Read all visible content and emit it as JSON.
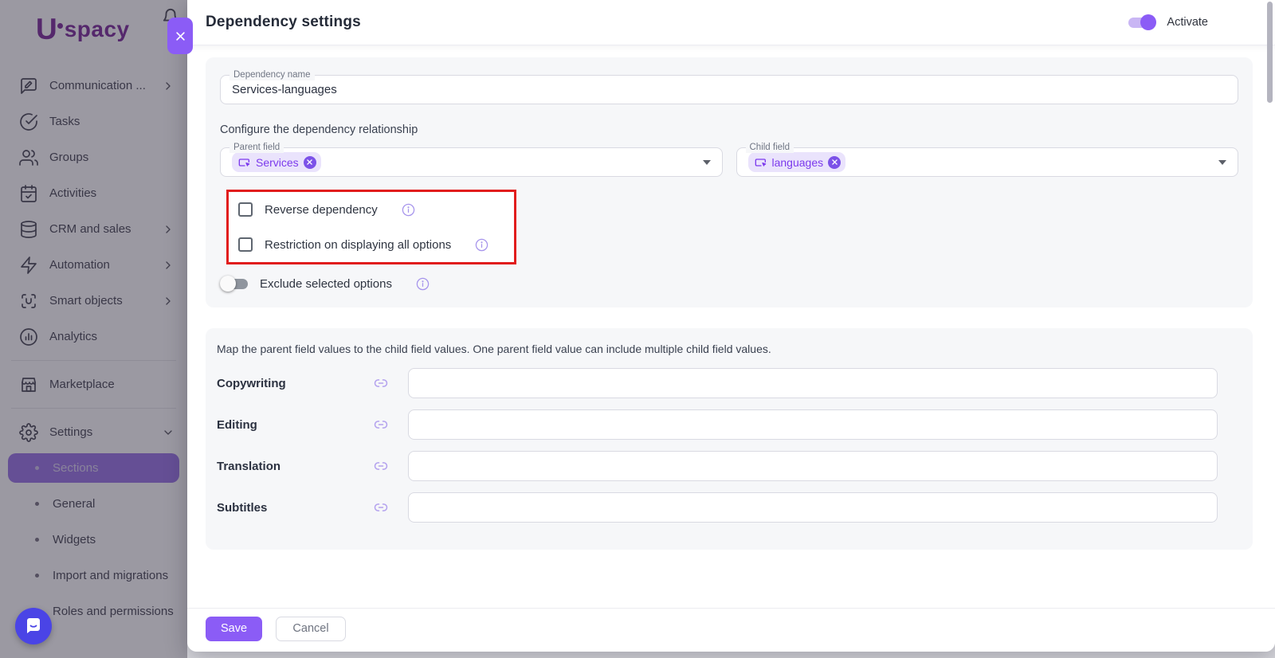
{
  "app": {
    "logo_initial": "U",
    "logo_text": "spacy"
  },
  "colors": {
    "accent": "#8b5cf6",
    "chip_bg": "#eae3fc",
    "chip_text": "#7c3aed",
    "red_annotation": "#e11d1d",
    "fab": "#4a44e6",
    "selected_item_bg": "#9a74e6"
  },
  "sidebar": {
    "items": [
      {
        "label": "Communication ..."
      },
      {
        "label": "Tasks"
      },
      {
        "label": "Groups"
      },
      {
        "label": "Activities"
      },
      {
        "label": "CRM and sales"
      },
      {
        "label": "Automation"
      },
      {
        "label": "Smart objects"
      },
      {
        "label": "Analytics"
      },
      {
        "label": "Marketplace"
      },
      {
        "label": "Settings"
      }
    ],
    "submenu": [
      {
        "label": "Sections",
        "selected": true
      },
      {
        "label": "General",
        "selected": false
      },
      {
        "label": "Widgets",
        "selected": false
      },
      {
        "label": "Import and migrations",
        "selected": false
      },
      {
        "label": "Roles and permissions",
        "selected": false
      }
    ]
  },
  "dialog": {
    "title": "Dependency settings",
    "activate": {
      "label": "Activate",
      "on": true
    },
    "name_field": {
      "label": "Dependency name",
      "value": "Services-languages"
    },
    "configure_heading": "Configure the dependency relationship",
    "parent_field": {
      "label": "Parent field",
      "chip": "Services"
    },
    "child_field": {
      "label": "Child field",
      "chip": "languages"
    },
    "checkboxes": [
      {
        "label": "Reverse dependency",
        "checked": false
      },
      {
        "label": "Restriction on displaying all options",
        "checked": false
      }
    ],
    "exclude_toggle": {
      "label": "Exclude selected options",
      "on": false
    },
    "mapping": {
      "heading": "Map the parent field values to the child field values. One parent field value can include multiple child field values.",
      "rows": [
        {
          "label": "Copywriting",
          "value": ""
        },
        {
          "label": "Editing",
          "value": ""
        },
        {
          "label": "Translation",
          "value": ""
        },
        {
          "label": "Subtitles",
          "value": ""
        }
      ]
    },
    "footer": {
      "save_label": "Save",
      "cancel_label": "Cancel"
    }
  }
}
